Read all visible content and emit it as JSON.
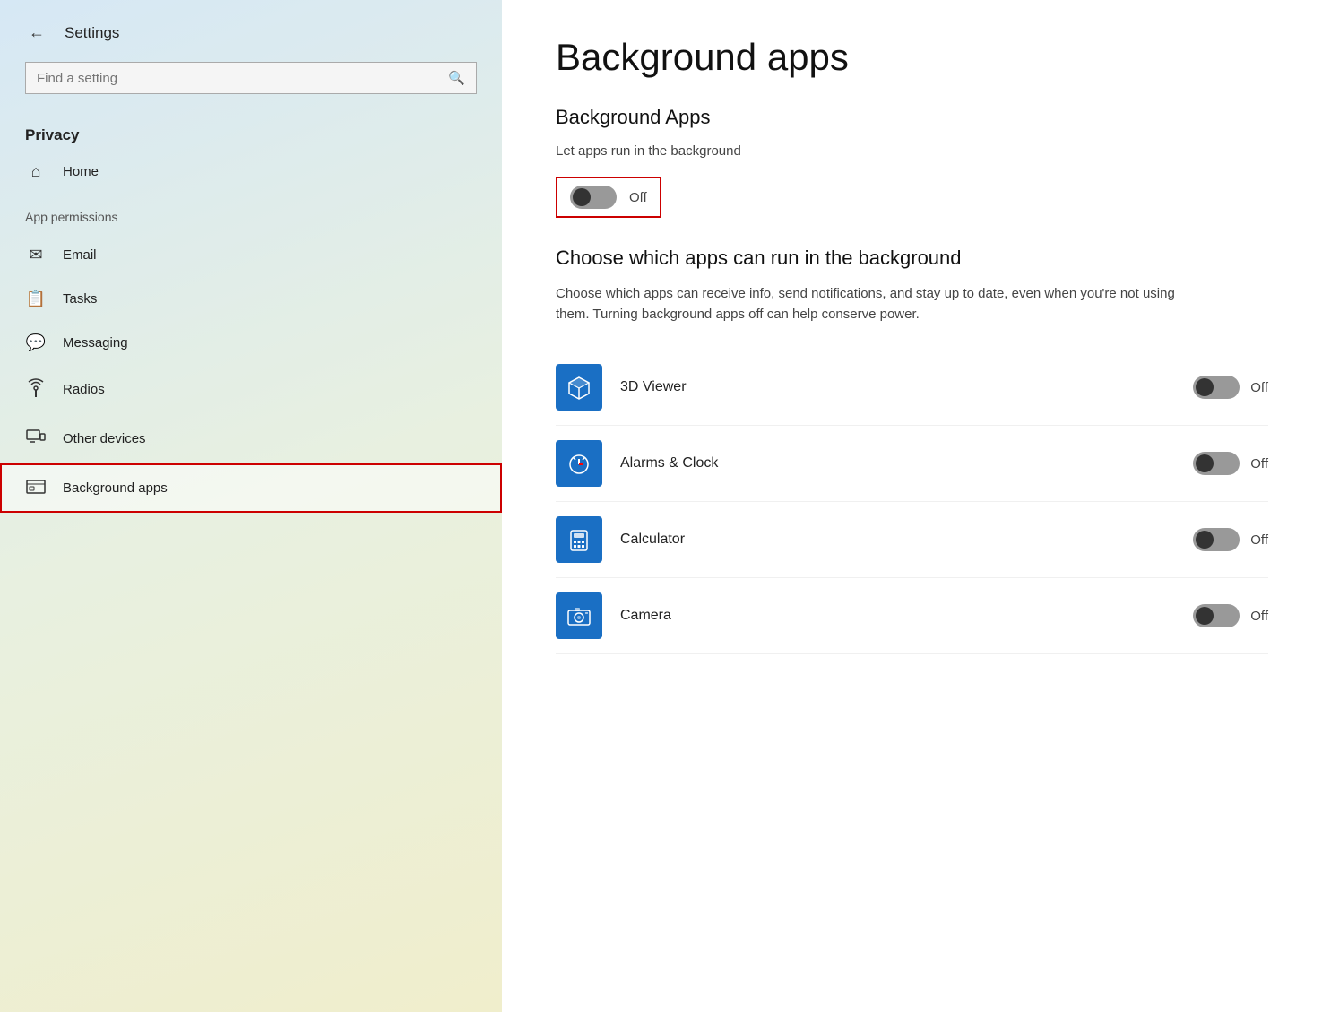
{
  "sidebar": {
    "title": "Settings",
    "search_placeholder": "Find a setting",
    "privacy_label": "Privacy",
    "app_permissions_label": "App permissions",
    "nav_items": [
      {
        "id": "home",
        "icon": "⌂",
        "label": "Home"
      },
      {
        "id": "email",
        "icon": "✉",
        "label": "Email"
      },
      {
        "id": "tasks",
        "icon": "📋",
        "label": "Tasks"
      },
      {
        "id": "messaging",
        "icon": "💬",
        "label": "Messaging"
      },
      {
        "id": "radios",
        "icon": "📡",
        "label": "Radios"
      },
      {
        "id": "other-devices",
        "icon": "🖥",
        "label": "Other devices"
      },
      {
        "id": "background-apps",
        "icon": "📊",
        "label": "Background apps",
        "active": true
      }
    ]
  },
  "content": {
    "page_title": "Background apps",
    "section1_title": "Background Apps",
    "let_apps_label": "Let apps run in the background",
    "toggle_off_label": "Off",
    "choose_title": "Choose which apps can run in the background",
    "choose_desc": "Choose which apps can receive info, send notifications, and stay up to date, even when you're not using them. Turning background apps off can help conserve power.",
    "apps": [
      {
        "id": "3dviewer",
        "name": "3D Viewer",
        "icon": "⬡",
        "icon_color": "#1a6fc4",
        "state": "off"
      },
      {
        "id": "alarms",
        "name": "Alarms & Clock",
        "icon": "🕐",
        "icon_color": "#1a6fc4",
        "state": "off"
      },
      {
        "id": "calculator",
        "name": "Calculator",
        "icon": "🔢",
        "icon_color": "#1a6fc4",
        "state": "off"
      },
      {
        "id": "camera",
        "name": "Camera",
        "icon": "📷",
        "icon_color": "#1a6fc4",
        "state": "off"
      }
    ],
    "off_label": "Off"
  }
}
